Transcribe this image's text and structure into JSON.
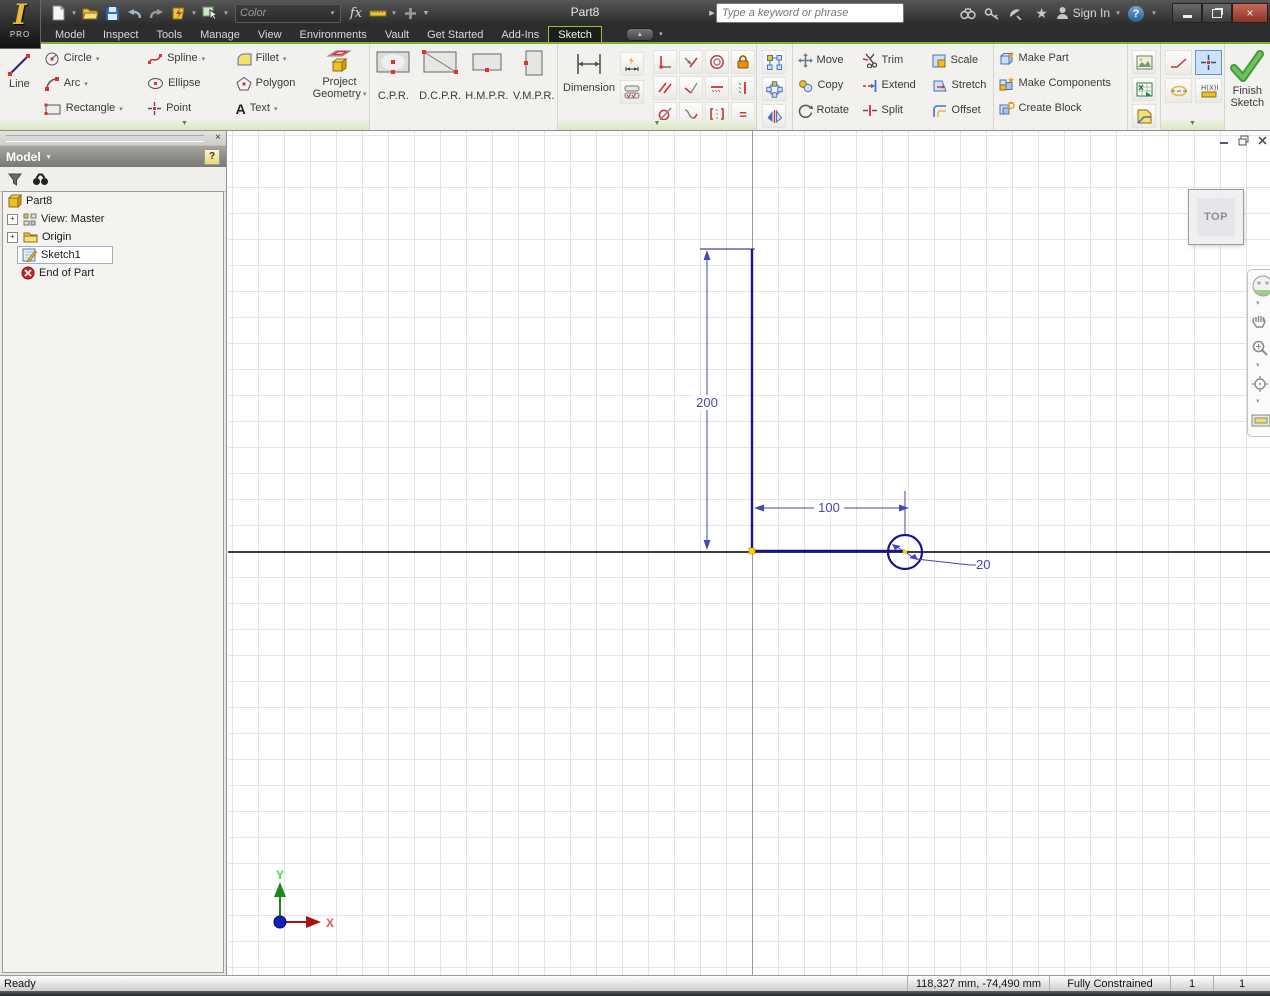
{
  "colors": {
    "accent_green": "#7db22f",
    "sketch_line_blue": "#16168c",
    "dimension_blue": "#4646b4",
    "selection_yellow": "#ffd400"
  },
  "icons": {
    "plus": "+",
    "caret": "▾",
    "caret_up": "▴",
    "close": "×",
    "question": "?",
    "star": "★",
    "fx": "fx",
    "equal": "=",
    "perpendicular": "⊥",
    "minus": "–",
    "binoculars": "⌕"
  },
  "titlebar": {
    "logo_badge": "PRO",
    "quick_access": {
      "color_combo_value": "Color"
    },
    "document_title": "Part8",
    "search_placeholder": "Type a keyword or phrase",
    "sign_in_label": "Sign In"
  },
  "tabs": {
    "items": [
      "Model",
      "Inspect",
      "Tools",
      "Manage",
      "View",
      "Environments",
      "Vault",
      "Get Started",
      "Add-Ins",
      "Sketch"
    ],
    "active": "Sketch"
  },
  "ribbon": {
    "draw": {
      "line": "Line",
      "circle": "Circle",
      "arc": "Arc",
      "rectangle": "Rectangle",
      "spline": "Spline",
      "ellipse": "Ellipse",
      "point": "Point",
      "fillet": "Fillet",
      "polygon": "Polygon",
      "text": "Text",
      "project_geometry_line1": "Project",
      "project_geometry_line2": "Geometry"
    },
    "custom_buttons": {
      "cpr": "C.P.R.",
      "dcpr": "D.C.P.R.",
      "hmpr": "H.M.P.R.",
      "vmpr": "V.M.P.R."
    },
    "constrain": {
      "dimension": "Dimension"
    },
    "modify": {
      "move": "Move",
      "copy": "Copy",
      "rotate": "Rotate",
      "trim": "Trim",
      "extend": "Extend",
      "split": "Split",
      "scale": "Scale",
      "stretch": "Stretch",
      "offset": "Offset"
    },
    "layout": {
      "make_part": "Make Part",
      "make_components": "Make Components",
      "create_block": "Create Block"
    },
    "exit": {
      "finish_line1": "Finish",
      "finish_line2": "Sketch"
    }
  },
  "browser": {
    "title": "Model",
    "tree": [
      {
        "label": "Part8"
      },
      {
        "label": "View: Master"
      },
      {
        "label": "Origin"
      },
      {
        "label": "Sketch1"
      },
      {
        "label": "End of Part"
      }
    ]
  },
  "canvas": {
    "viewcube_face": "TOP",
    "dimensions": {
      "vertical": "200",
      "horizontal": "100",
      "diameter": "20"
    },
    "triad": {
      "x": "X",
      "y": "Y"
    }
  },
  "statusbar": {
    "message": "Ready",
    "coordinates": "118,327 mm, -74,490 mm",
    "constraint_status": "Fully Constrained",
    "sketch_number": "1",
    "dof_number": "1"
  }
}
